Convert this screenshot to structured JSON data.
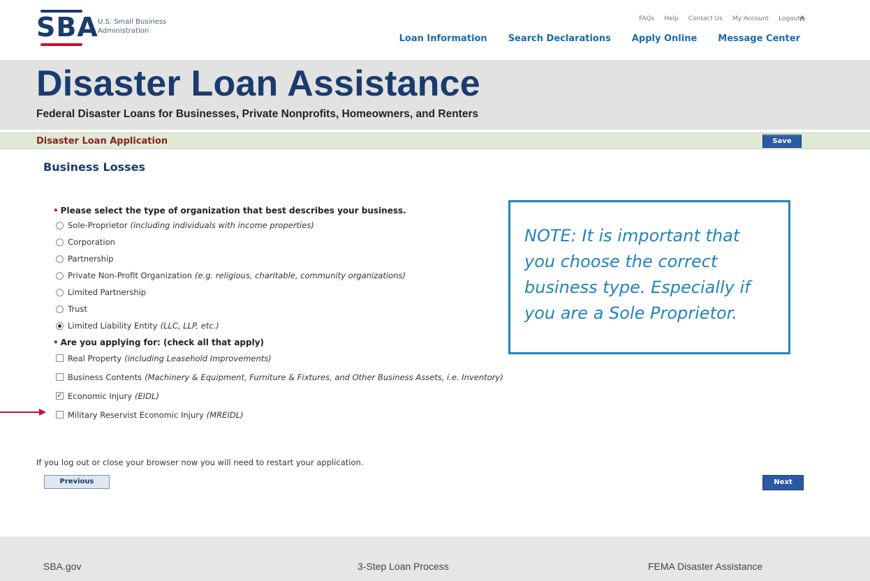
{
  "header": {
    "logo_letters": "SBA",
    "logo_text": "U.S. Small Business Administration",
    "util_links": [
      "FAQs",
      "Help",
      "Contact Us",
      "My Account",
      "Logout"
    ],
    "main_nav": [
      "Loan Information",
      "Search Declarations",
      "Apply Online",
      "Message Center"
    ]
  },
  "banner": {
    "title": "Disaster Loan Assistance",
    "subtitle": "Federal Disaster Loans for Businesses, Private Nonprofits, Homeowners, and Renters"
  },
  "app_bar": {
    "title": "Disaster Loan Application",
    "save_label": "Save"
  },
  "section_title": "Business Losses",
  "org_question": {
    "label": "Please select the type of organization that best describes your business.",
    "options": [
      {
        "label": "Sole-Proprietor",
        "note": "(including individuals with income properties)",
        "selected": false
      },
      {
        "label": "Corporation",
        "note": "",
        "selected": false
      },
      {
        "label": "Partnership",
        "note": "",
        "selected": false
      },
      {
        "label": "Private Non-Profit Organization",
        "note": "(e.g. religious, charitable, community organizations)",
        "selected": false
      },
      {
        "label": "Limited Partnership",
        "note": "",
        "selected": false
      },
      {
        "label": "Trust",
        "note": "",
        "selected": false
      },
      {
        "label": "Limited Liability Entity",
        "note": "(LLC, LLP, etc.)",
        "selected": true
      }
    ]
  },
  "apply_question": {
    "label": "Are you applying for: (check all that apply)",
    "options": [
      {
        "label": "Real Property",
        "note": "(including Leasehold Improvements)",
        "checked": false
      },
      {
        "label": "Business Contents",
        "note": "(Machinery & Equipment, Furniture & Fixtures, and Other Business Assets, i.e. Inventory)",
        "checked": false
      },
      {
        "label": "Economic Injury",
        "note": "(EIDL)",
        "checked": true
      },
      {
        "label": "Military Reservist Economic Injury",
        "note": "(MREIDL)",
        "checked": false
      }
    ]
  },
  "note": "NOTE: It is important that you choose the correct business type. Especially if you are a Sole Proprietor.",
  "warning": "If you log out or close your browser now you will need to restart your application.",
  "buttons": {
    "previous": "Previous",
    "next": "Next"
  },
  "footer": [
    "SBA.gov",
    "3-Step Loan Process",
    "FEMA Disaster Assistance"
  ],
  "colors": {
    "brand_navy": "#1a3b6e",
    "link_blue": "#1a6ab0",
    "note_blue": "#2184bd",
    "app_title_red": "#8a1f1f",
    "arrow_red": "#c8102e"
  }
}
